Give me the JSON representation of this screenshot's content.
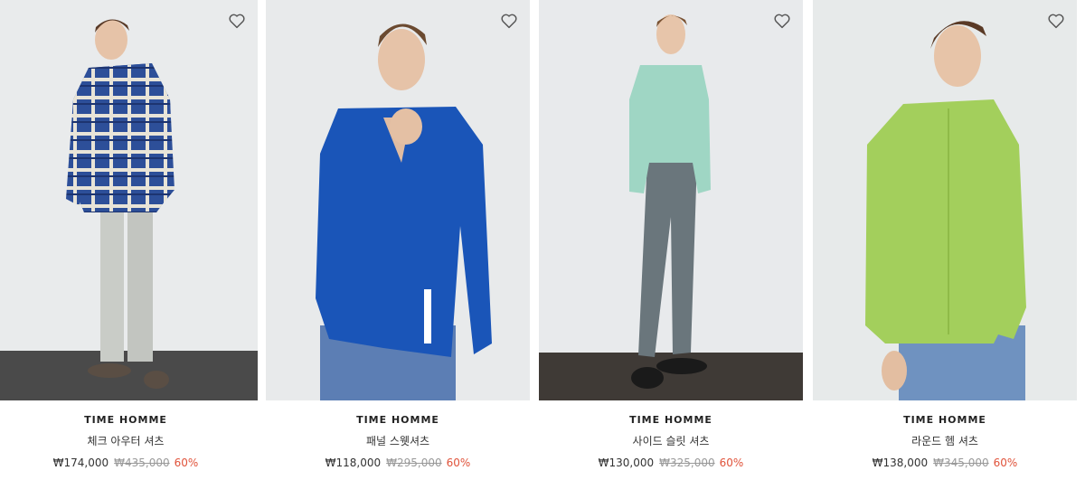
{
  "products": [
    {
      "brand": "TIME HOMME",
      "name": "체크 아우터 셔츠",
      "price": "₩174,000",
      "original_price": "₩435,000",
      "discount": "60%"
    },
    {
      "brand": "TIME HOMME",
      "name": "패널 스웻셔츠",
      "price": "₩118,000",
      "original_price": "₩295,000",
      "discount": "60%"
    },
    {
      "brand": "TIME HOMME",
      "name": "사이드 슬릿 셔츠",
      "price": "₩130,000",
      "original_price": "₩325,000",
      "discount": "60%"
    },
    {
      "brand": "TIME HOMME",
      "name": "라운드 헴 셔츠",
      "price": "₩138,000",
      "original_price": "₩345,000",
      "discount": "60%"
    }
  ],
  "icons": {
    "wishlist": "heart-outline-icon"
  },
  "colors": {
    "discount": "#e0533b",
    "original_price": "#999999",
    "text": "#222222"
  }
}
